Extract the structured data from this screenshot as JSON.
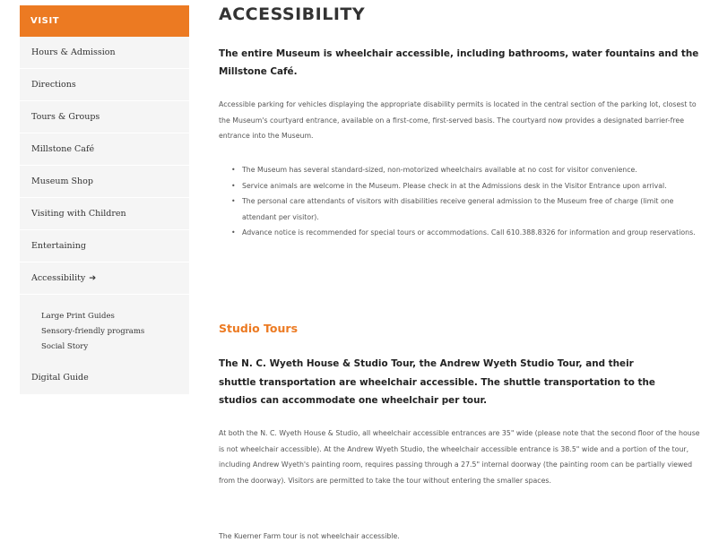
{
  "sidebar": {
    "heading": "VISIT",
    "items": [
      {
        "label": "Hours & Admission"
      },
      {
        "label": "Directions"
      },
      {
        "label": "Tours & Groups"
      },
      {
        "label": "Millstone Café"
      },
      {
        "label": "Museum Shop"
      },
      {
        "label": "Visiting with Children"
      },
      {
        "label": "Entertaining"
      },
      {
        "label": "Accessibility",
        "arrow": "➔"
      }
    ],
    "subitems": [
      {
        "label": "Large Print Guides"
      },
      {
        "label": "Sensory-friendly programs"
      },
      {
        "label": "Social Story"
      }
    ],
    "footer_item": {
      "label": "Digital Guide"
    }
  },
  "main": {
    "title": "ACCESSIBILITY",
    "lead": "The entire Museum is wheelchair accessible, including bathrooms, water fountains and the Millstone Café.",
    "paragraph1": "Accessible parking for vehicles displaying the appropriate disability permits is located in the central section of the parking lot, closest to the Museum's courtyard entrance, available on a first-come, first-served basis. The courtyard now provides a designated barrier-free entrance into the Museum.",
    "bullet_char": "•",
    "bullets": [
      "The Museum has several standard-sized, non-motorized wheelchairs available at no cost for visitor convenience.",
      "Service animals are welcome in the Museum. Please check in at the Admissions desk in the Visitor Entrance upon arrival.",
      "The personal care attendants of visitors with disabilities receive general admission to the Museum free of charge (limit one attendant per visitor).",
      "Advance notice is recommended for special tours or accommodations. Call 610.388.8326 for information and group reservations."
    ],
    "section_heading": "Studio Tours",
    "lead2": "The N. C. Wyeth House & Studio Tour, the Andrew Wyeth Studio Tour, and their shuttle transportation are wheelchair accessible. The shuttle transportation to the studios can accommodate one wheelchair per tour.",
    "paragraph2": "At both the N. C. Wyeth House & Studio, all wheelchair accessible entrances are 35\" wide (please note that the second floor of the house is not wheelchair accessible). At the Andrew Wyeth Studio, the wheelchair accessible entrance is 38.5\" wide and a portion of the tour, including Andrew Wyeth's painting room, requires passing through a 27.5\" internal doorway (the painting room can be partially viewed from the doorway). Visitors are permitted to take the tour without entering the smaller spaces.",
    "paragraph3": "The Kuerner Farm tour is not wheelchair accessible."
  },
  "colors": {
    "accent": "#ec7a22",
    "sidebar_bg": "#f5f5f5",
    "heading_text": "#333333",
    "body_text": "#555555"
  }
}
